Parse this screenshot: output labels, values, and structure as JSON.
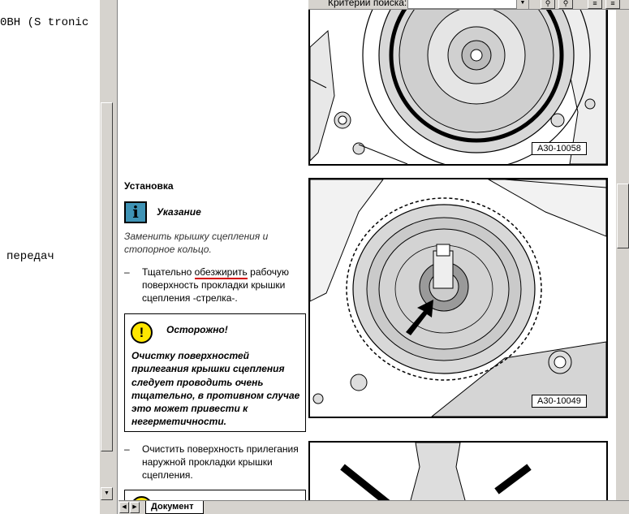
{
  "left_pane": {
    "lines": [
      "0BH (S tronic",
      "передач"
    ]
  },
  "search": {
    "label": "Критерии поиска:",
    "value": ""
  },
  "figures": {
    "fig1_label": "A30-10058",
    "fig2_label": "A30-10049"
  },
  "content": {
    "heading": "Установка",
    "note_icon": "i",
    "note_title": "Указание",
    "note_text": "Заменить крышку сцепления и стопорное кольцо.",
    "step1_dash": "–",
    "step1_before": "Тщательно ",
    "step1_underlined": "обезжирить",
    "step1_after": " рабочую поверхность прокладки крышки сцепления -стрелка-.",
    "warning_icon": "!",
    "warning_title": "Осторожно!",
    "warning_text": "Очистку поверхностей прилегания крышки сцепления следует проводить очень тщательно, в противном случае это может привести к негерметичности.",
    "step2_dash": "–",
    "step2_text": "Очистить поверхность прилегания наружной прокладки крышки сцепления."
  },
  "tabs": {
    "active_label": "Документ"
  },
  "colors": {
    "note_icon_bg": "#3f93b5",
    "warning_icon_bg": "#ffe600",
    "underline": "#d40000"
  },
  "icons": {
    "note": "info-icon",
    "warning": "warning-icon"
  }
}
